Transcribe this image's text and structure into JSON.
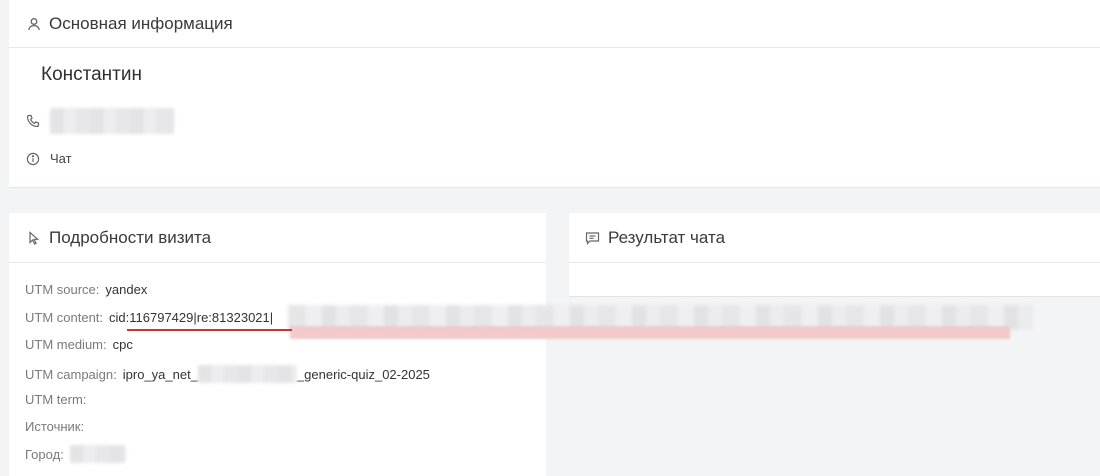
{
  "main_section": {
    "title": "Основная информация",
    "contact_name": "Константин",
    "source_label": "Чат"
  },
  "visit_section": {
    "title": "Подробности визита",
    "rows": [
      {
        "label": "UTM source:",
        "value": "yandex"
      },
      {
        "label": "UTM content:",
        "value": "cid:116797429|re:81323021|"
      },
      {
        "label": "UTM medium:",
        "value": "cpc"
      },
      {
        "label": "UTM campaign:",
        "value_prefix": "ipro_ya_net_",
        "value_suffix": "_generic-quiz_02-2025"
      },
      {
        "label": "UTM term:",
        "value": ""
      },
      {
        "label": "Источник:",
        "value": ""
      },
      {
        "label": "Город:",
        "value": ""
      }
    ]
  },
  "chat_section": {
    "title": "Результат чата"
  },
  "icons": {
    "user": "user-icon",
    "phone": "phone-icon",
    "info": "info-icon",
    "cursor": "cursor-icon",
    "chat": "chat-icon"
  },
  "colors": {
    "underline": "#c9372c",
    "background": "#f3f4f6"
  }
}
